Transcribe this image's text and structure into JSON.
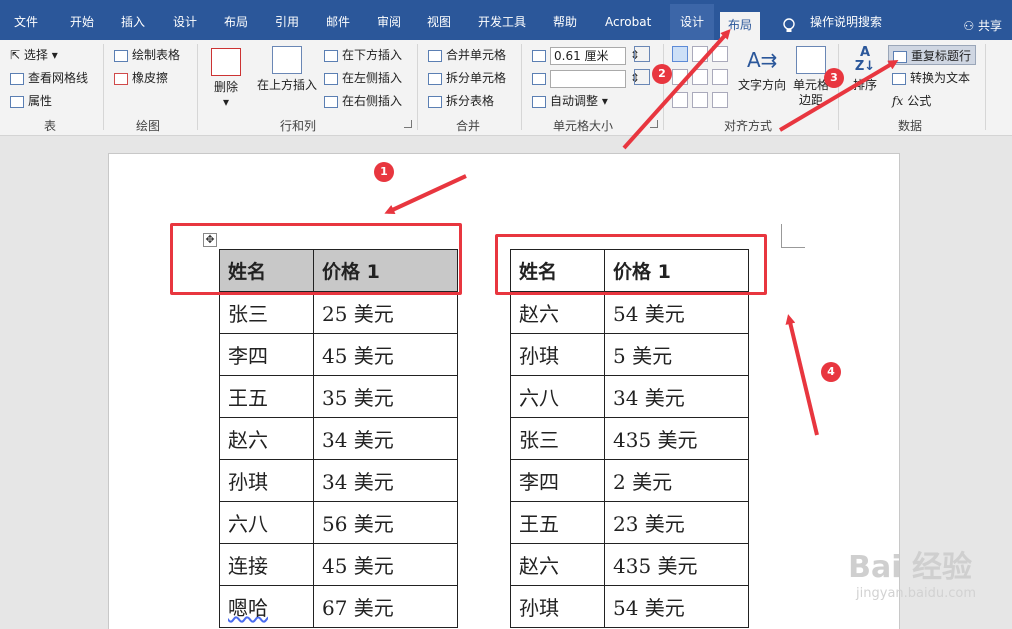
{
  "tabs": [
    "文件",
    "开始",
    "插入",
    "设计",
    "布局",
    "引用",
    "邮件",
    "审阅",
    "视图",
    "开发工具",
    "帮助",
    "Acrobat"
  ],
  "context_tabs": {
    "design": "设计",
    "layout": "布局"
  },
  "tell_me": "操作说明搜索",
  "share": "共享",
  "ribbon": {
    "table": {
      "label": "表",
      "select": "选择",
      "gridlines": "查看网格线",
      "properties": "属性"
    },
    "draw": {
      "label": "绘图",
      "draw_table": "绘制表格",
      "eraser": "橡皮擦"
    },
    "rows_cols": {
      "label": "行和列",
      "delete": "删除",
      "insert_above": "在上方插入",
      "insert_below": "在下方插入",
      "insert_left": "在左侧插入",
      "insert_right": "在右侧插入"
    },
    "merge": {
      "label": "合并",
      "merge_cells": "合并单元格",
      "split_cells": "拆分单元格",
      "split_table": "拆分表格"
    },
    "cell_size": {
      "label": "单元格大小",
      "height_value": "0.61 厘米",
      "width_value": "",
      "autofit": "自动调整"
    },
    "alignment": {
      "label": "对齐方式",
      "text_direction": "文字方向",
      "cell_margins": "单元格边距"
    },
    "data": {
      "label": "数据",
      "sort": "排序",
      "repeat_header": "重复标题行",
      "convert_to_text": "转换为文本",
      "formula": "公式"
    }
  },
  "table1": {
    "header": [
      "姓名",
      "价格 1"
    ],
    "rows": [
      [
        "张三",
        "25 美元"
      ],
      [
        "李四",
        "45 美元"
      ],
      [
        "王五",
        "35 美元"
      ],
      [
        "赵六",
        "34 美元"
      ],
      [
        "孙琪",
        "34 美元"
      ],
      [
        "六八",
        "56 美元"
      ],
      [
        "连接",
        "45 美元"
      ],
      [
        "嗯哈",
        "67 美元"
      ]
    ]
  },
  "table2": {
    "header": [
      "姓名",
      "价格 1"
    ],
    "rows": [
      [
        "赵六",
        "54 美元"
      ],
      [
        "孙琪",
        "5 美元"
      ],
      [
        "六八",
        "34 美元"
      ],
      [
        "张三",
        "435 美元"
      ],
      [
        "李四",
        "2 美元"
      ],
      [
        "王五",
        "23 美元"
      ],
      [
        "赵六",
        "435 美元"
      ],
      [
        "孙琪",
        "54 美元"
      ]
    ]
  },
  "annotations": [
    "1",
    "2",
    "3",
    "4"
  ],
  "watermark": {
    "brand": "Bai 经验",
    "url": "jingyan.baidu.com"
  },
  "colors": {
    "ribbon_blue": "#2b579a",
    "annotation_red": "#e8363f",
    "header_fill": "#c8c8c8"
  }
}
